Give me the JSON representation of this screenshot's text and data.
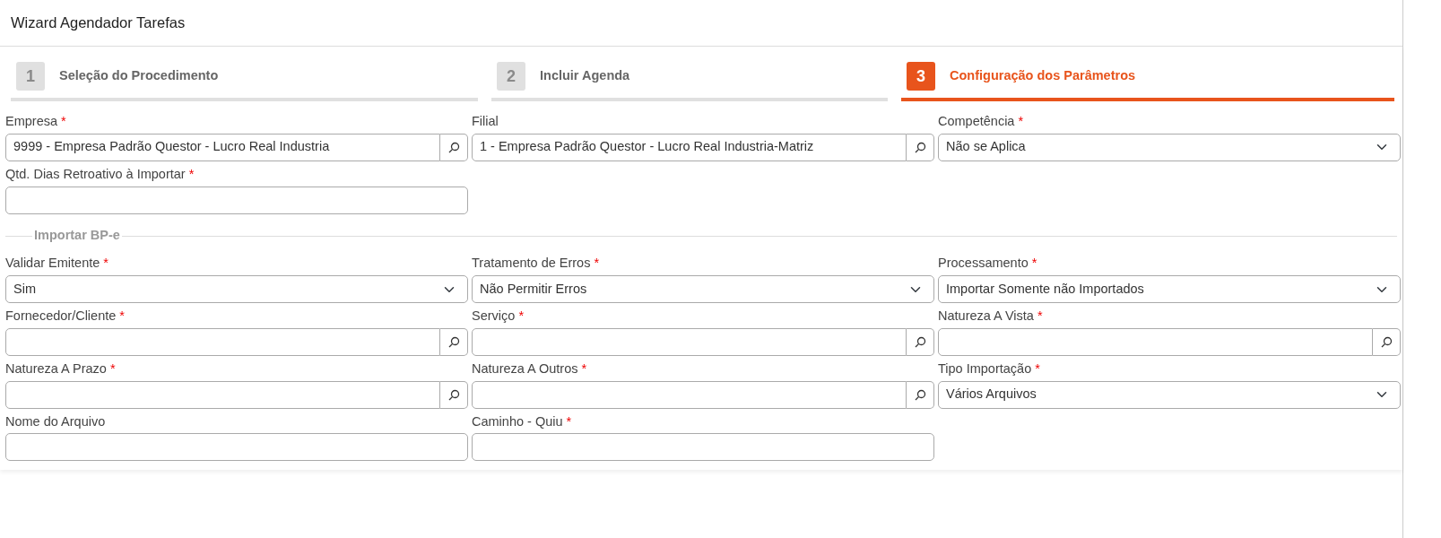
{
  "window": {
    "title": "Wizard Agendador Tarefas"
  },
  "steps": [
    {
      "number": "1",
      "label": "Seleção do Procedimento",
      "selected": false
    },
    {
      "number": "2",
      "label": "Incluir Agenda",
      "selected": false
    },
    {
      "number": "3",
      "label": "Configuração dos Parâmetros",
      "selected": true
    }
  ],
  "fields": [
    {
      "kind": "lookup",
      "label": "Empresa",
      "required_mark": "*",
      "value": "9999 - Empresa Padrão Questor - Lucro Real Industria"
    },
    {
      "kind": "lookup",
      "label": "Filial",
      "value": "1 - Empresa Padrão Questor - Lucro Real Industria-Matriz"
    },
    {
      "kind": "select",
      "label": "Competência",
      "required_mark": "*",
      "value": "Não se Aplica"
    },
    {
      "kind": "text",
      "label": "Qtd. Dias Retroativo à Importar",
      "required_mark": "*"
    }
  ],
  "fieldset": {
    "legend": "Importar BP-e",
    "fields": [
      {
        "kind": "select",
        "label": "Validar Emitente",
        "required_mark": "*",
        "value": "Sim"
      },
      {
        "kind": "select",
        "label": "Tratamento de Erros",
        "required_mark": "*",
        "value": "Não Permitir Erros"
      },
      {
        "kind": "select",
        "label": "Processamento",
        "required_mark": "*",
        "value": "Importar Somente não Importados"
      },
      {
        "kind": "lookup",
        "label": "Fornecedor/Cliente",
        "required_mark": "*"
      },
      {
        "kind": "lookup",
        "label": "Serviço",
        "required_mark": "*"
      },
      {
        "kind": "lookup",
        "label": "Natureza A Vista",
        "required_mark": "*"
      },
      {
        "kind": "lookup",
        "label": "Natureza A Prazo",
        "required_mark": "*"
      },
      {
        "kind": "lookup",
        "label": "Natureza A Outros",
        "required_mark": "*"
      },
      {
        "kind": "select",
        "label": "Tipo Importação",
        "required_mark": "*",
        "value": "Vários Arquivos"
      },
      {
        "kind": "text",
        "label": "Nome do Arquivo"
      },
      {
        "kind": "text",
        "label": "Caminho - Quiu",
        "required_mark": "*"
      }
    ]
  }
}
